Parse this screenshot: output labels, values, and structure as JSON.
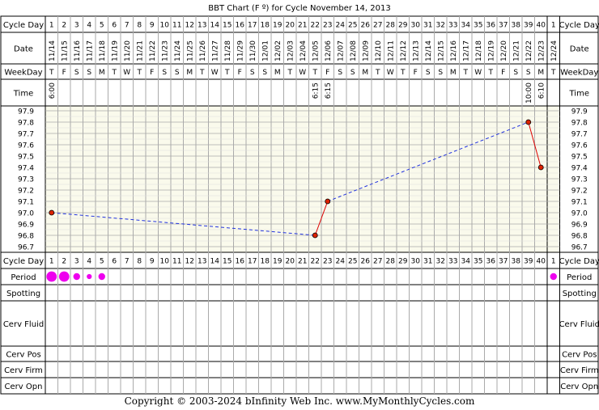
{
  "title": "BBT Chart (F º) for Cycle November 14, 2013",
  "row_labels": {
    "cycle_day": "Cycle Day",
    "date": "Date",
    "weekday": "WeekDay",
    "time": "Time",
    "period": "Period",
    "spotting": "Spotting",
    "cerv_fluid": "Cerv Fluid",
    "cerv_pos": "Cerv Pos",
    "cerv_firm": "Cerv Firm",
    "cerv_opn": "Cerv Opn"
  },
  "cycle_days": [
    "1",
    "2",
    "3",
    "4",
    "5",
    "6",
    "7",
    "8",
    "9",
    "10",
    "11",
    "12",
    "13",
    "14",
    "15",
    "16",
    "17",
    "18",
    "19",
    "20",
    "21",
    "22",
    "23",
    "24",
    "25",
    "26",
    "27",
    "28",
    "29",
    "30",
    "31",
    "32",
    "33",
    "34",
    "35",
    "36",
    "37",
    "38",
    "39",
    "40",
    "1"
  ],
  "dates": [
    "11/14",
    "11/15",
    "11/16",
    "11/17",
    "11/18",
    "11/19",
    "11/20",
    "11/21",
    "11/22",
    "11/23",
    "11/24",
    "11/25",
    "11/26",
    "11/27",
    "11/28",
    "11/29",
    "11/30",
    "12/01",
    "12/02",
    "12/03",
    "12/04",
    "12/05",
    "12/06",
    "12/07",
    "12/08",
    "12/09",
    "12/10",
    "12/11",
    "12/12",
    "12/13",
    "12/14",
    "12/15",
    "12/16",
    "12/17",
    "12/18",
    "12/19",
    "12/20",
    "12/21",
    "12/22",
    "12/23",
    "12/24"
  ],
  "weekdays": [
    "T",
    "F",
    "S",
    "S",
    "M",
    "T",
    "W",
    "T",
    "F",
    "S",
    "S",
    "M",
    "T",
    "W",
    "T",
    "F",
    "S",
    "S",
    "M",
    "T",
    "W",
    "T",
    "F",
    "S",
    "S",
    "M",
    "T",
    "W",
    "T",
    "F",
    "S",
    "S",
    "M",
    "T",
    "W",
    "T",
    "F",
    "S",
    "S",
    "M",
    "T"
  ],
  "times": [
    "6:00",
    "",
    "",
    "",
    "",
    "",
    "",
    "",
    "",
    "",
    "",
    "",
    "",
    "",
    "",
    "",
    "",
    "",
    "",
    "",
    "",
    "6:15",
    "6:15",
    "",
    "",
    "",
    "",
    "",
    "",
    "",
    "",
    "",
    "",
    "",
    "",
    "",
    "",
    "",
    "10:00",
    "6:10",
    ""
  ],
  "temp_axis_labels": [
    "97.9",
    "97.8",
    "97.7",
    "97.6",
    "97.5",
    "97.4",
    "97.3",
    "97.2",
    "97.1",
    "97.0",
    "96.9",
    "96.8",
    "96.7"
  ],
  "period": [
    2,
    2,
    1,
    0.5,
    1,
    0,
    0,
    0,
    0,
    0,
    0,
    0,
    0,
    0,
    0,
    0,
    0,
    0,
    0,
    0,
    0,
    0,
    0,
    0,
    0,
    0,
    0,
    0,
    0,
    0,
    0,
    0,
    0,
    0,
    0,
    0,
    0,
    0,
    0,
    0,
    1
  ],
  "colors": {
    "title_bg": "#ffffff",
    "grid_line": "#aaaaaa",
    "plot_bg": "#fafaec",
    "header_bg": "#f0f0f0",
    "period_dot": "#ee00ee",
    "solid_line": "#dd0000",
    "dashed_line": "#2233dd",
    "point_fill": "#dd2200"
  },
  "chart_data": {
    "type": "line",
    "title": "BBT Chart (F º) for Cycle November 14, 2013",
    "xlabel": "Cycle Day",
    "ylabel": "",
    "x": [
      1,
      22,
      23,
      39,
      40
    ],
    "y": [
      97.0,
      96.8,
      97.1,
      97.8,
      97.4
    ],
    "ylim": [
      96.7,
      97.9
    ],
    "segments": [
      "dashed",
      "solid",
      "dashed",
      "solid"
    ],
    "grid": true
  },
  "footer": {
    "copyright": "Copyright © 2003-2024 bInfinity Web Inc.     www.MyMonthlyCycles.com"
  }
}
